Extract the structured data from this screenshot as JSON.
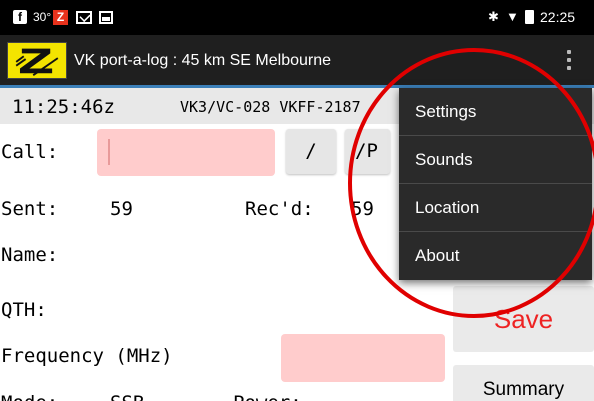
{
  "status_bar": {
    "fb_glyph": "f",
    "temperature": "30°",
    "z_glyph": "Z",
    "bluetooth_glyph": "✱",
    "wifi_glyph": "▼",
    "time": "22:25"
  },
  "action_bar": {
    "title": "VK port-a-log : 45 km SE Melbourne",
    "overflow_icon": "more-vert-icon"
  },
  "info_line": {
    "utc_time": "11:25:46z",
    "references": "VK3/VC-028 VKFF-2187"
  },
  "form": {
    "call_label": "Call:",
    "call_value": "",
    "slash_button": "/",
    "portable_button": "/P",
    "sent_label": "Sent:",
    "sent_value": "59",
    "recd_label": "Rec'd:",
    "recd_value": "59",
    "name_label": "Name:",
    "qth_label": "QTH:",
    "frequency_label": "Frequency (MHz)",
    "frequency_value": "",
    "mode_label": "Mode:",
    "mode_value": "SSB",
    "power_label": "Power:"
  },
  "buttons": {
    "save": "Save",
    "summary": "Summary"
  },
  "menu": {
    "items": [
      "Settings",
      "Sounds",
      "Location",
      "About"
    ]
  },
  "colors": {
    "status_bar": "#000000",
    "action_bar": "#1f1f1f",
    "accent_line": "#3b7fb8",
    "input_fill": "#ffcccc",
    "save_text": "#ee2323",
    "annotation": "#e00000",
    "logo": "#f4e400"
  }
}
